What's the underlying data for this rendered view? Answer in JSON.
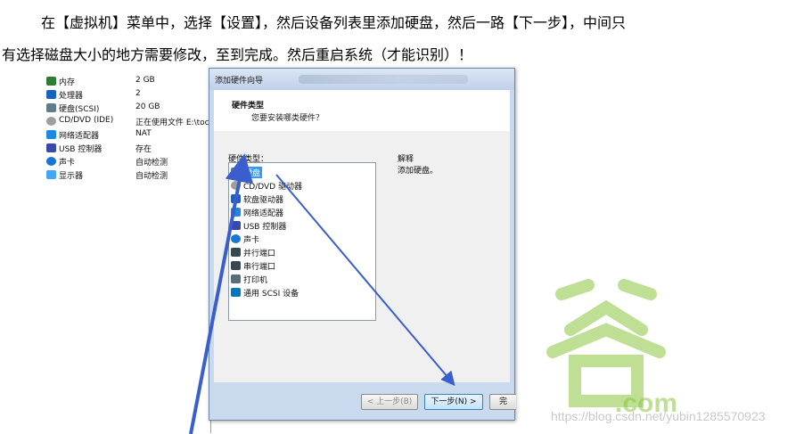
{
  "instruction": {
    "line1": "在【虚拟机】菜单中，选择【设置】，然后设备列表里添加硬盘，然后一路【下一步】，中间只",
    "line2": "有选择磁盘大小的地方需要修改，至到完成。然后重启系统（才能识别）！"
  },
  "vm_devices": [
    {
      "name": "内存",
      "value": "2 GB",
      "icon": "memory-icon",
      "color": "#2e7d32"
    },
    {
      "name": "处理器",
      "value": "2",
      "icon": "processor-icon",
      "color": "#1565c0"
    },
    {
      "name": "硬盘(SCSI)",
      "value": "20 GB",
      "icon": "harddisk-icon",
      "color": "#607d8b"
    },
    {
      "name": "CD/DVD (IDE)",
      "value": "正在使用文件 E:\\toc",
      "icon": "cdrom-icon",
      "color": "#9e9e9e"
    },
    {
      "name": "网络适配器",
      "value": "NAT",
      "icon": "network-icon",
      "color": "#1e88e5"
    },
    {
      "name": "USB 控制器",
      "value": "存在",
      "icon": "usb-icon",
      "color": "#3949ab"
    },
    {
      "name": "声卡",
      "value": "自动检测",
      "icon": "sound-icon",
      "color": "#1976d2"
    },
    {
      "name": "显示器",
      "value": "自动检测",
      "icon": "monitor-icon",
      "color": "#42a5f5"
    }
  ],
  "wizard": {
    "title": "添加硬件向导",
    "header_title": "硬件类型",
    "header_subtitle": "您要安装哪类硬件？",
    "type_label": "硬件类型：",
    "explain_label": "解释",
    "explain_text": "添加硬盘。",
    "hardware_types": [
      {
        "label": "硬盘",
        "icon": "harddisk-icon",
        "color": "#607d8b",
        "selected": true
      },
      {
        "label": "CD/DVD 驱动器",
        "icon": "cdrom-icon",
        "color": "#9e9e9e",
        "selected": false
      },
      {
        "label": "软盘驱动器",
        "icon": "floppy-icon",
        "color": "#1565c0",
        "selected": false
      },
      {
        "label": "网络适配器",
        "icon": "network-icon",
        "color": "#1e88e5",
        "selected": false
      },
      {
        "label": "USB 控制器",
        "icon": "usb-icon",
        "color": "#3949ab",
        "selected": false
      },
      {
        "label": "声卡",
        "icon": "sound-icon",
        "color": "#1976d2",
        "selected": false
      },
      {
        "label": "并行端口",
        "icon": "parallel-port-icon",
        "color": "#37474f",
        "selected": false
      },
      {
        "label": "串行端口",
        "icon": "serial-port-icon",
        "color": "#37474f",
        "selected": false
      },
      {
        "label": "打印机",
        "icon": "printer-icon",
        "color": "#546e7a",
        "selected": false
      },
      {
        "label": "通用 SCSI 设备",
        "icon": "scsi-icon",
        "color": "#0277bd",
        "selected": false
      }
    ],
    "back_button": "< 上一步(B)",
    "next_button": "下一步(N) >",
    "finish_button": "完"
  },
  "watermark": {
    "url": "https://blog.csdn.net/yubin1285570923",
    "logo_text": ".com",
    "logo_color": "#8cc63f"
  },
  "colors": {
    "annotation_arrow": "#3a5fcd",
    "selection": "#3399ff"
  }
}
